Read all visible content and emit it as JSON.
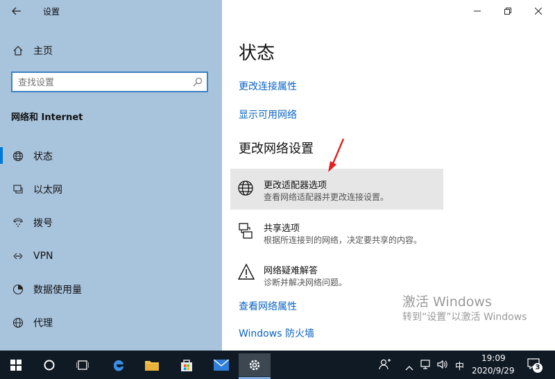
{
  "window": {
    "title": "设置",
    "back_icon": "back-arrow-icon"
  },
  "sidebar": {
    "home_label": "主页",
    "search_placeholder": "查找设置",
    "section_title": "网络和 Internet",
    "items": [
      {
        "label": "状态",
        "icon": "globe-icon"
      },
      {
        "label": "以太网",
        "icon": "monitor-icon"
      },
      {
        "label": "拨号",
        "icon": "phone-dial-icon"
      },
      {
        "label": "VPN",
        "icon": "vpn-icon"
      },
      {
        "label": "数据使用量",
        "icon": "data-usage-icon"
      },
      {
        "label": "代理",
        "icon": "proxy-globe-icon"
      }
    ]
  },
  "main": {
    "page_title": "状态",
    "link_change_conn_props": "更改连接属性",
    "link_show_networks": "显示可用网络",
    "section_title": "更改网络设置",
    "options": [
      {
        "title": "更改适配器选项",
        "desc": "查看网络适配器并更改连接设置。",
        "icon": "adapter-globe-icon"
      },
      {
        "title": "共享选项",
        "desc": "根据所连接到的网络，决定要共享的内容。",
        "icon": "sharing-icon"
      },
      {
        "title": "网络疑难解答",
        "desc": "诊断并解决网络问题。",
        "icon": "warning-icon"
      }
    ],
    "link_view_props": "查看网络属性",
    "link_firewall": "Windows 防火墙"
  },
  "watermark": {
    "line1": "激活 Windows",
    "line2": "转到“设置”以激活 Windows"
  },
  "taskbar": {
    "time": "19:09",
    "date": "2020/9/29",
    "ime": "中",
    "notifications": "3"
  },
  "colors": {
    "sidebar_bg": "#a8c3dc",
    "accent": "#0a63c7",
    "active_indicator": "#0078d7",
    "highlight_bg": "#e6e6e6",
    "taskbar_bg": "#101a24",
    "annotation_arrow": "#e02020"
  }
}
